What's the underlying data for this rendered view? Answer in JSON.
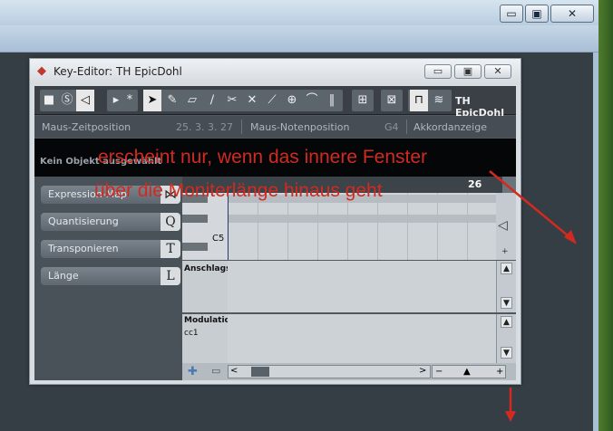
{
  "outer_window": {
    "minimize": "▭",
    "maximize": "▣",
    "close": "✕"
  },
  "key_editor": {
    "title": "Key-Editor: TH EpicDohl",
    "title_buttons": {
      "minimize": "▭",
      "maximize": "▣",
      "close": "✕"
    },
    "toolbar": {
      "track_name": "TH EpicDohl"
    },
    "infoline": {
      "zeit_label": "Maus-Zeitposition",
      "zeit_value": "25. 3. 3. 27",
      "note_label": "Maus-Notenposition",
      "note_value": "G4",
      "akkord_label": "Akkordanzeige"
    },
    "status": "Kein Objekt ausgewählt",
    "inspector": [
      {
        "label": "Expression-Map",
        "key": "⋈"
      },
      {
        "label": "Quantisierung",
        "key": "Q"
      },
      {
        "label": "Transponieren",
        "key": "T"
      },
      {
        "label": "Länge",
        "key": "L"
      }
    ],
    "ruler": {
      "bar": "26"
    },
    "keys": {
      "c5": "C5"
    },
    "lanes": {
      "velocity": "Anschlags",
      "modulation": "Modulatic",
      "cc": "cc1"
    }
  },
  "annotations": {
    "line1": "erscheint nur, wenn das innere Fenster",
    "line2": "über die Moniterlänge hinaus geht",
    "color": "#d22a20"
  }
}
